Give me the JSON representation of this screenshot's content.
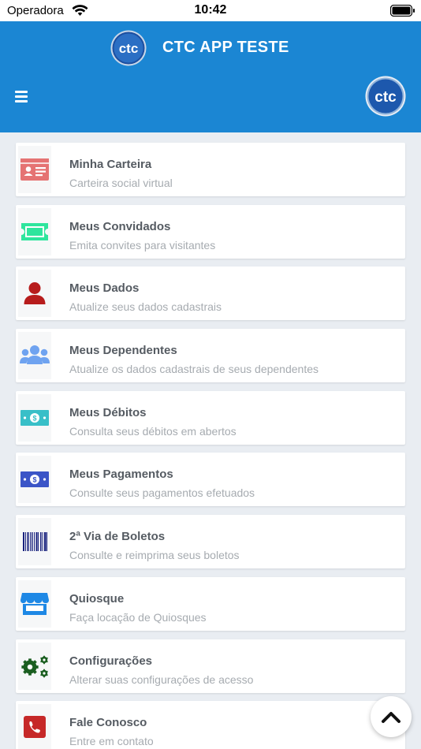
{
  "status_bar": {
    "carrier": "Operadora",
    "time": "10:42"
  },
  "header": {
    "title": "CTC APP TESTE",
    "logo_text": "ctc"
  },
  "menu": [
    {
      "title": "Minha Carteira",
      "subtitle": "Carteira social virtual",
      "icon": "id-card-icon",
      "color": "#e57373"
    },
    {
      "title": "Meus Convidados",
      "subtitle": "Emita convites para visitantes",
      "icon": "ticket-icon",
      "color": "#2ee59d"
    },
    {
      "title": "Meus Dados",
      "subtitle": "Atualize seus dados cadastrais",
      "icon": "user-icon",
      "color": "#b71c1c"
    },
    {
      "title": "Meus Dependentes",
      "subtitle": "Atualize os dados cadastrais de seus dependentes",
      "icon": "users-icon",
      "color": "#6fa3f0"
    },
    {
      "title": "Meus Débitos",
      "subtitle": "Consulta seus débitos em abertos",
      "icon": "money-bill-icon",
      "color": "#38bfc8"
    },
    {
      "title": "Meus Pagamentos",
      "subtitle": "Consulte seus pagamentos efetuados",
      "icon": "money-bill-icon",
      "color": "#3b55c7"
    },
    {
      "title": "2ª Via de Boletos",
      "subtitle": "Consulte e reimprima seus boletos",
      "icon": "barcode-icon",
      "color": "#1a237e"
    },
    {
      "title": "Quiosque",
      "subtitle": "Faça locação de Quiosques",
      "icon": "store-icon",
      "color": "#1e88e5"
    },
    {
      "title": "Configurações",
      "subtitle": "Alterar suas configurações de acesso",
      "icon": "gears-icon",
      "color": "#1b5e20"
    },
    {
      "title": "Fale Conosco",
      "subtitle": "Entre em contato",
      "icon": "phone-icon",
      "color": "#c62828"
    }
  ]
}
